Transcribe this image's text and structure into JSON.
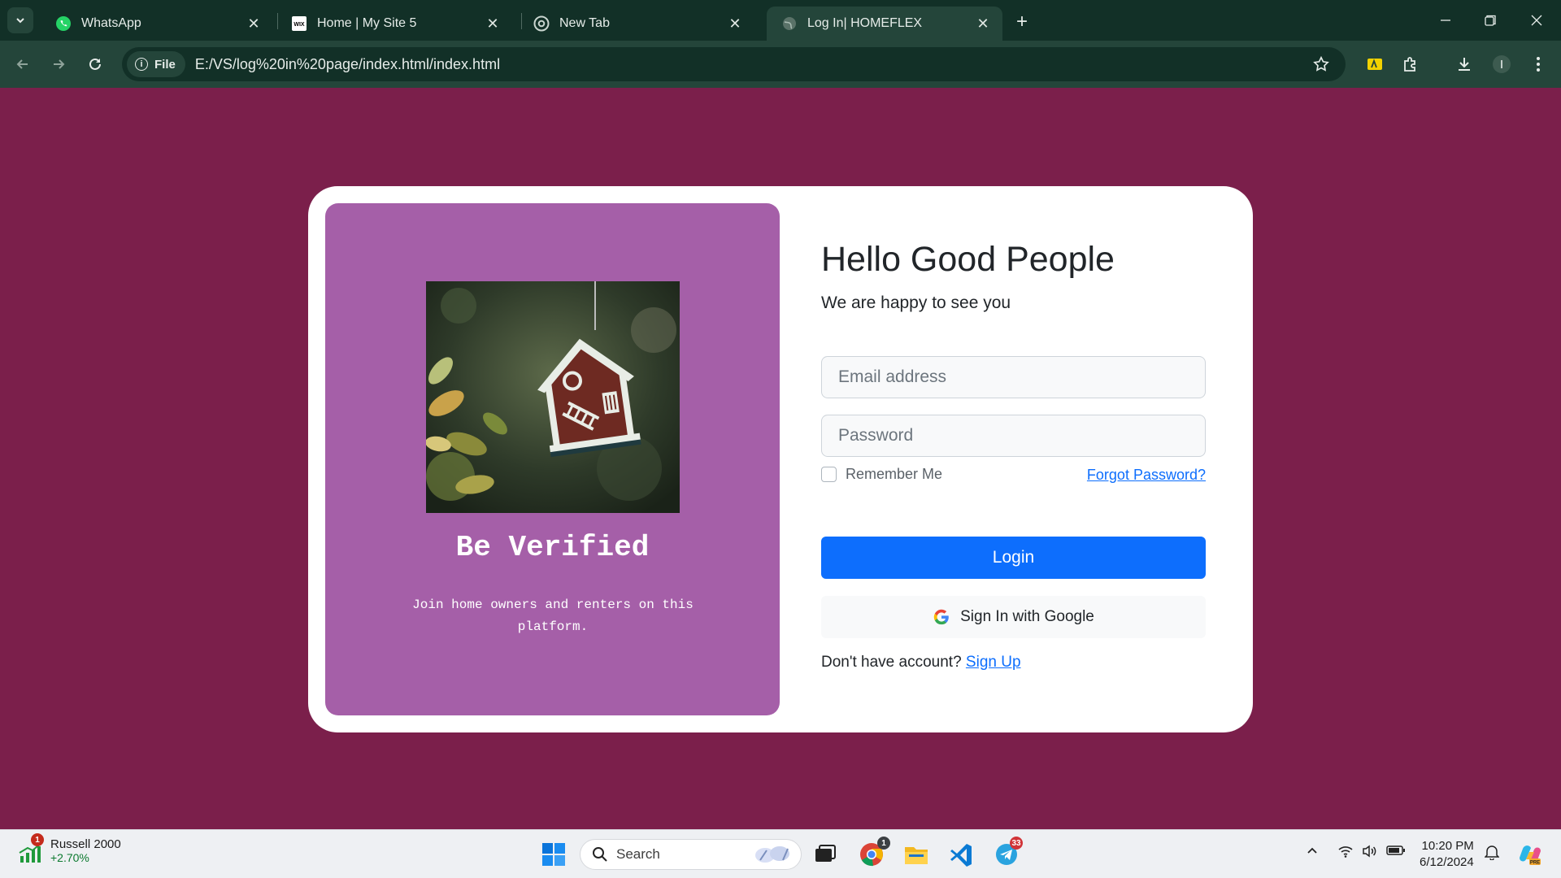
{
  "browser": {
    "tabs": [
      {
        "title": "WhatsApp",
        "icon": "whatsapp-icon"
      },
      {
        "title": "Home | My Site 5",
        "icon": "wix-icon"
      },
      {
        "title": "New Tab",
        "icon": "chrome-icon"
      },
      {
        "title": "Log In| HOMEFLEX",
        "icon": "globe-icon",
        "active": true
      }
    ],
    "site_chip": "File",
    "url": "E:/VS/log%20in%20page/index.html/index.html"
  },
  "page": {
    "colors": {
      "background": "#7b1f4b",
      "panel": "#a55fa8",
      "primary": "#0d6efd"
    },
    "left_panel": {
      "image": "birdhouse-photo",
      "title": "Be Verified",
      "subtitle": "Join home owners and renters on this platform."
    },
    "form": {
      "heading": "Hello Good People",
      "subheading": "We are happy to see you",
      "email_placeholder": "Email address",
      "password_placeholder": "Password",
      "remember_label": "Remember Me",
      "forgot_link": "Forgot Password?",
      "login_button": "Login",
      "google_button": "Sign In with Google",
      "no_account_text": "Don't have account?",
      "signup_link": "Sign Up"
    }
  },
  "taskbar": {
    "widget": {
      "name": "Russell 2000",
      "change": "+2.70%",
      "badge": "1"
    },
    "search_label": "Search",
    "chrome_badge": "1",
    "telegram_badge": "33",
    "time": "10:20 PM",
    "date": "6/12/2024"
  }
}
